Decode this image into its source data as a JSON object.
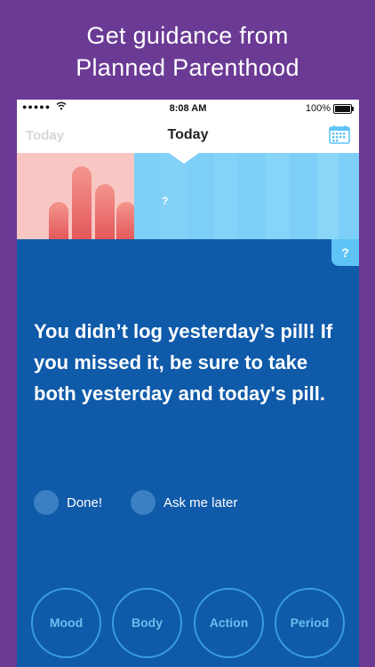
{
  "promo": {
    "line1": "Get guidance from",
    "line2": "Planned Parenthood"
  },
  "status_bar": {
    "signal": "●●●●●",
    "time": "8:08 AM",
    "battery": "100%"
  },
  "nav": {
    "prev_label": "Today",
    "title": "Today",
    "calendar_icon": "calendar-icon"
  },
  "hero": {
    "unknown_marker": "?"
  },
  "help": {
    "label": "?"
  },
  "message": "You didn’t log yesterday’s pill! If you missed it, be sure to take both yesterday and today's pill.",
  "options": [
    {
      "label": "Done!"
    },
    {
      "label": "Ask me later"
    }
  ],
  "bottom_buttons": [
    {
      "label": "Mood"
    },
    {
      "label": "Body"
    },
    {
      "label": "Action"
    },
    {
      "label": "Period"
    }
  ],
  "colors": {
    "promo_background": "#6b3a95",
    "main_background": "#0f5aa9",
    "accent_light_blue": "#5ec4f5",
    "hero_pink": "#f8c7c4",
    "bar_red": "#e4585a"
  }
}
